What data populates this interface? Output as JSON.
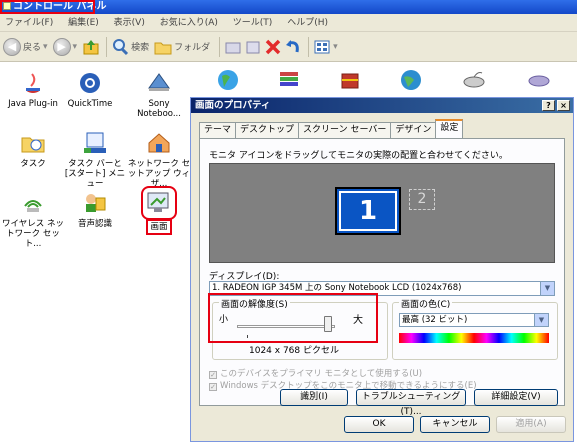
{
  "window": {
    "title": "コントロール パネル"
  },
  "menu": [
    "ファイル(F)",
    "編集(E)",
    "表示(V)",
    "お気に入り(A)",
    "ツール(T)",
    "ヘルプ(H)"
  ],
  "toolbar": {
    "back": "戻る",
    "search": "検索",
    "folders": "フォルダ"
  },
  "icons": [
    {
      "label": "Java Plug-in"
    },
    {
      "label": "QuickTime"
    },
    {
      "label": "Sony Noteboo..."
    },
    {
      "label": "タスク"
    },
    {
      "label": "タスク バーと [スタート] メニュー"
    },
    {
      "label": "ネットワーク セットアップ ウィザ..."
    },
    {
      "label": "ワイヤレス ネットワーク セット..."
    },
    {
      "label": "音声認識"
    },
    {
      "label": "画面"
    }
  ],
  "dialog": {
    "title": "画面のプロパティ",
    "help_btn": "?",
    "close_btn": "×",
    "tabs": [
      "テーマ",
      "デスクトップ",
      "スクリーン セーバー",
      "デザイン",
      "設定"
    ],
    "active_tab": "設定",
    "instruction": "モニタ アイコンをドラッグしてモニタの実際の配置と合わせてください。",
    "monitor1": "1",
    "monitor2": "2",
    "display_label": "ディスプレイ(D):",
    "display_value": "1. RADEON IGP 345M 上の Sony Notebook LCD (1024x768)",
    "resolution": {
      "legend": "画面の解像度(S)",
      "min_label": "小",
      "max_label": "大",
      "value": "1024 x 768 ピクセル"
    },
    "color": {
      "legend": "画面の色(C)",
      "value": "最高 (32 ビット)"
    },
    "check1": "このデバイスをプライマリ モニタとして使用する(U)",
    "check2": "Windows デスクトップをこのモニタ上で移動できるようにする(E)",
    "buttons": {
      "identify": "識別(I)",
      "troubleshoot": "トラブルシューティング(T)...",
      "advanced": "詳細設定(V)",
      "ok": "OK",
      "cancel": "キャンセル",
      "apply": "適用(A)"
    }
  }
}
